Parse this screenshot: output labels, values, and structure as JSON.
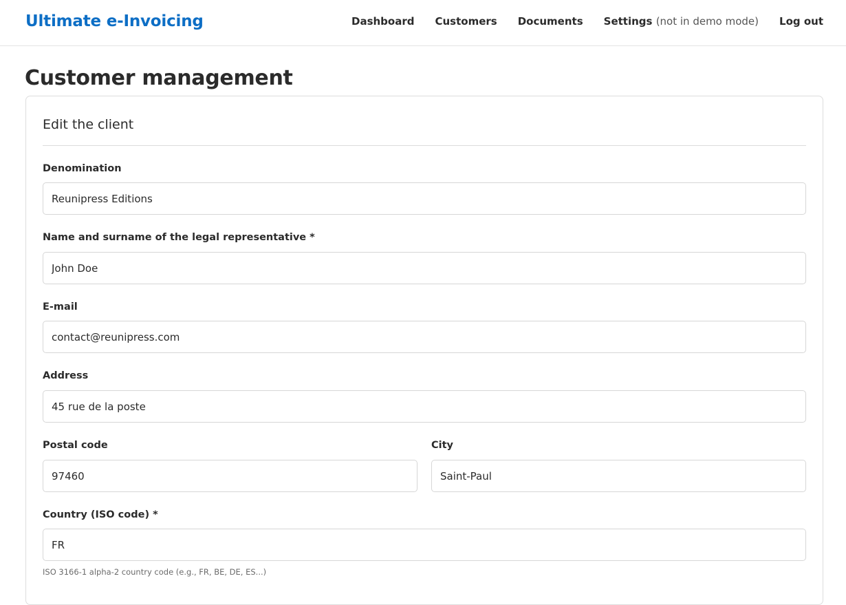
{
  "header": {
    "brand": "Ultimate e-Invoicing",
    "nav": {
      "dashboard": "Dashboard",
      "customers": "Customers",
      "documents": "Documents",
      "settings": "Settings",
      "settings_note": "(not in demo mode)",
      "logout": "Log out"
    },
    "brand_color": "#0d6ec5"
  },
  "page": {
    "title": "Customer management"
  },
  "form": {
    "title": "Edit the client",
    "fields": {
      "denomination": {
        "label": "Denomination",
        "value": "Reunipress Editions"
      },
      "legal_rep": {
        "label": "Name and surname of the legal representative *",
        "value": "John Doe"
      },
      "email": {
        "label": "E-mail",
        "value": "contact@reunipress.com"
      },
      "address": {
        "label": "Address",
        "value": "45 rue de la poste"
      },
      "postal_code": {
        "label": "Postal code",
        "value": "97460"
      },
      "city": {
        "label": "City",
        "value": "Saint-Paul"
      },
      "country": {
        "label": "Country (ISO code) *",
        "value": "FR",
        "help": "ISO 3166-1 alpha-2 country code (e.g., FR, BE, DE, ES...)"
      }
    }
  }
}
